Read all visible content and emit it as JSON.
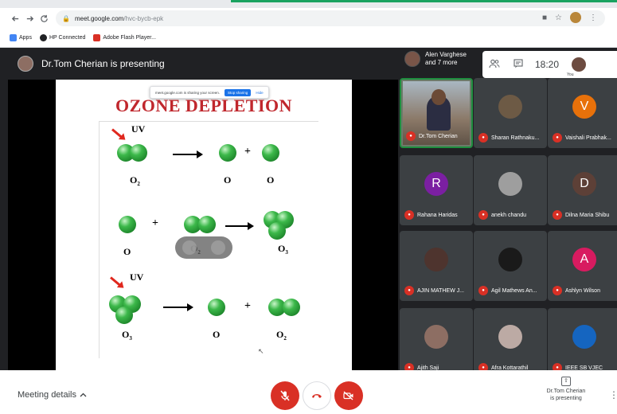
{
  "colors": {
    "tab_accent": "#1aa260",
    "chrome_bg": "#e8eaed",
    "meet_bg": "#202124",
    "tile_bg": "#3c4043",
    "end_call_red": "#d93025",
    "slide_title_red": "#c0272d"
  },
  "browser": {
    "nav": {
      "back_icon": "arrow-left-icon",
      "forward_icon": "arrow-right-icon",
      "reload_icon": "reload-icon"
    },
    "url_host": "meet.google.com",
    "url_path": "/hvc-bycb-epk",
    "bookmarks": [
      {
        "label": "Apps",
        "color": "#4285f4"
      },
      {
        "label": "HP Connected",
        "color": "#202124"
      },
      {
        "label": "Adobe Flash Player...",
        "color": "#d93025"
      }
    ]
  },
  "presenter_bar": {
    "text": "Dr.Tom Cherian is presenting"
  },
  "share_pill": {
    "text": "meet.google.com is sharing your screen.",
    "stop_label": "Stop sharing",
    "hide_label": "Hide"
  },
  "slide": {
    "title": "OZONE DEPLETION",
    "uv_label_1": "UV",
    "uv_label_2": "UV",
    "row1": {
      "o2": "O",
      "o2_sub": "2",
      "o_a": "O",
      "o_b": "O"
    },
    "row2": {
      "o": "O",
      "o2": "O",
      "o2_sub": "2",
      "o3": "O",
      "o3_sub": "3"
    },
    "row3": {
      "o3": "O",
      "o3_sub": "3",
      "o": "O",
      "o2": "O",
      "o2_sub": "2"
    }
  },
  "top_info": {
    "line1": "Alen Varghese",
    "line2": "and 7 more"
  },
  "panel": {
    "people_icon": "people-icon",
    "chat_icon": "chat-icon",
    "time": "18:20",
    "you_label": "You"
  },
  "tiles": [
    {
      "name": "Dr.Tom Cherian",
      "type": "self"
    },
    {
      "name": "Sharan Rathnaku...",
      "type": "photo",
      "color": "#6d5a45"
    },
    {
      "name": "Vaishali Prabhak...",
      "type": "letter",
      "letter": "V",
      "color": "#e8710a"
    },
    {
      "name": "Rahana Haridas",
      "type": "letter",
      "letter": "R",
      "color": "#7b1fa2"
    },
    {
      "name": "anekh chandu",
      "type": "photo",
      "color": "#9e9e9e"
    },
    {
      "name": "Dilna Maria Shibu",
      "type": "letter",
      "letter": "D",
      "color": "#5d4037"
    },
    {
      "name": "AJIN MATHEW J...",
      "type": "photo",
      "color": "#4e342e"
    },
    {
      "name": "Agil Mathews An...",
      "type": "photo",
      "color": "#1a1a1a"
    },
    {
      "name": "Ashlyn Wilson",
      "type": "letter",
      "letter": "A",
      "color": "#d81b60"
    },
    {
      "name": "Ajith Saji",
      "type": "photo",
      "color": "#8d6e63"
    },
    {
      "name": "Afra Kottarathil",
      "type": "photo",
      "color": "#bcaaa4"
    },
    {
      "name": "IEEE SB VJEC",
      "type": "photo",
      "color": "#1565c0"
    }
  ],
  "bottom": {
    "details_label": "Meeting details",
    "details_icon": "chevron-up-icon",
    "mic_icon": "mic-off-icon",
    "hangup_icon": "call-end-icon",
    "cam_icon": "videocam-off-icon",
    "presenting_line1": "Dr.Tom Cherian",
    "presenting_line2": "is presenting",
    "more_icon": "more-vert-icon"
  }
}
